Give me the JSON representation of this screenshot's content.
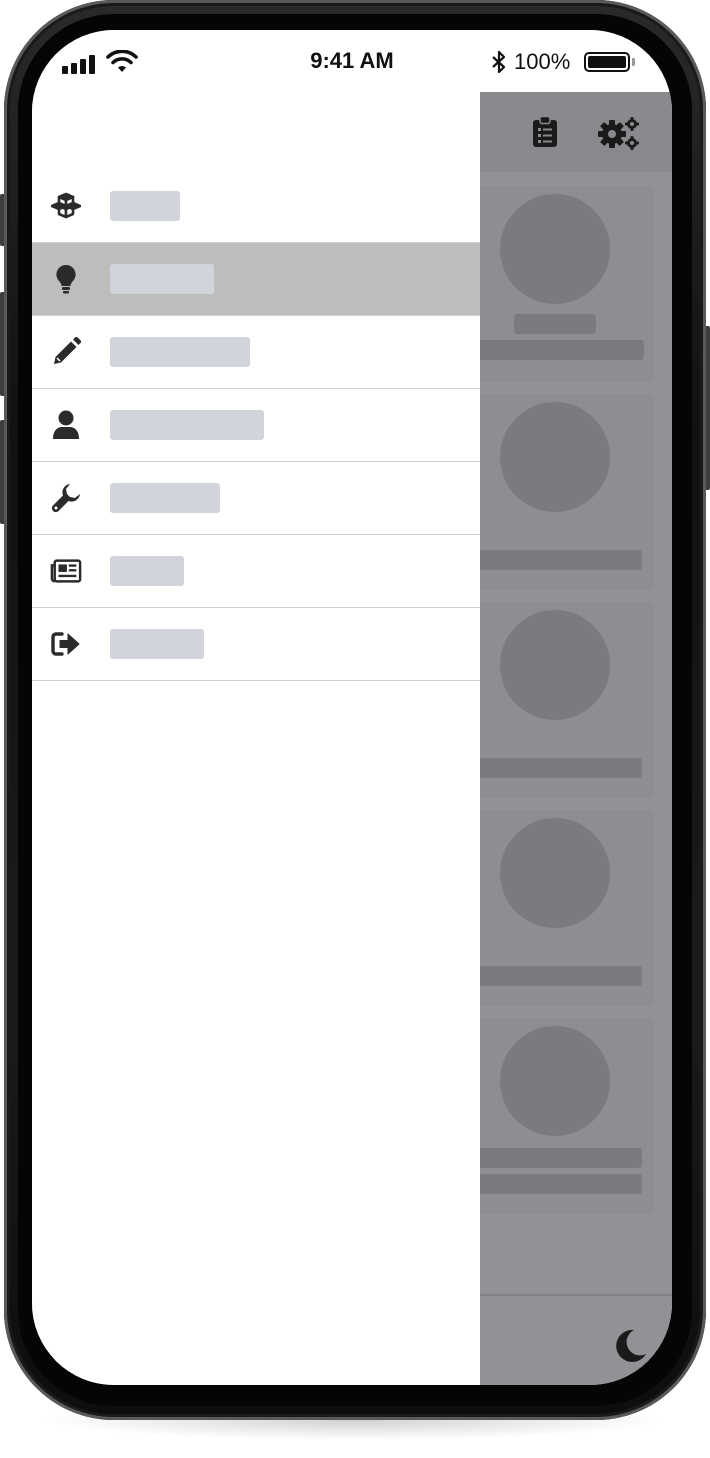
{
  "status_bar": {
    "time": "9:41 AM",
    "battery_percent": "100%",
    "signal_bars": 4
  },
  "header_actions": [
    {
      "icon": "clipboard-list-icon"
    },
    {
      "icon": "cogs-icon"
    }
  ],
  "drawer": {
    "items": [
      {
        "icon": "cubes-icon",
        "label": "",
        "active": false
      },
      {
        "icon": "lightbulb-icon",
        "label": "",
        "active": true
      },
      {
        "icon": "pencil-icon",
        "label": "",
        "active": false
      },
      {
        "icon": "user-icon",
        "label": "",
        "active": false
      },
      {
        "icon": "wrench-icon",
        "label": "",
        "active": false
      },
      {
        "icon": "newspaper-icon",
        "label": "",
        "active": false
      },
      {
        "icon": "sign-out-icon",
        "label": "",
        "active": false
      }
    ]
  },
  "background_cards": {
    "count": 5
  },
  "bottom_bar": {
    "icon": "moon-icon"
  },
  "colors": {
    "drawer_bg": "#ffffff",
    "active_item_bg": "#bdbdbd",
    "placeholder_label": "#d1d5db",
    "overlay_bg": "#929296",
    "icon_color": "#333333"
  }
}
